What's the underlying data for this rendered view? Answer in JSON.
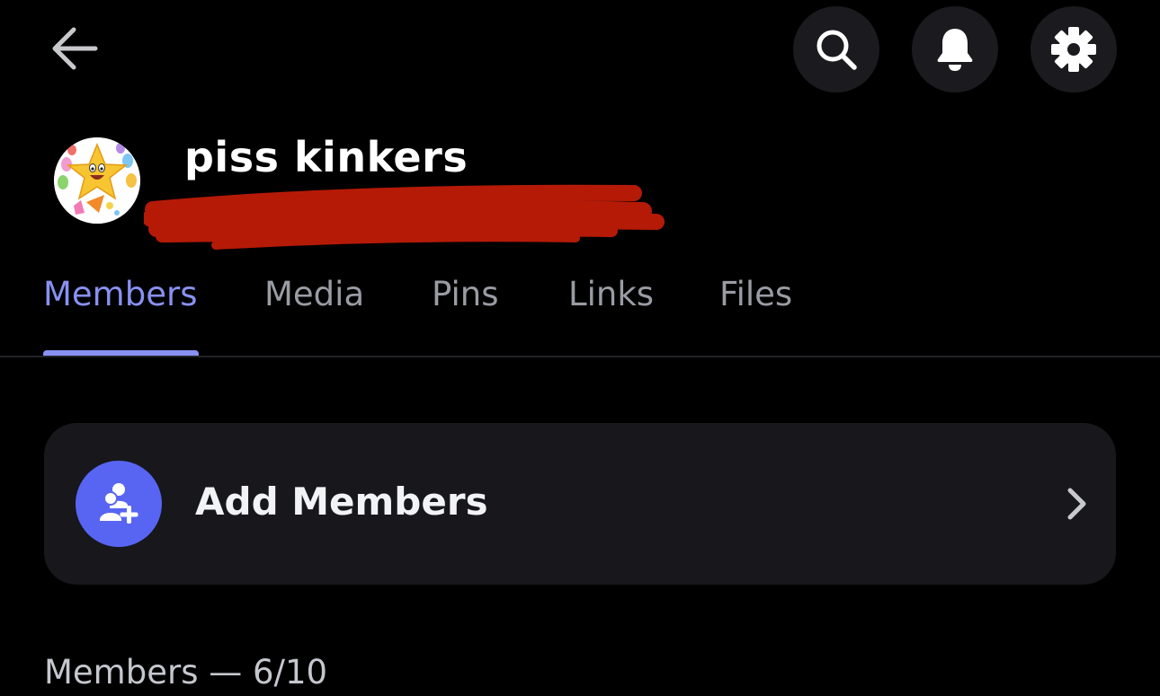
{
  "header": {
    "back_icon": "arrow-left-icon",
    "actions": [
      {
        "icon": "search-icon"
      },
      {
        "icon": "bell-icon"
      },
      {
        "icon": "gear-icon"
      }
    ]
  },
  "group": {
    "name": "piss kinkers",
    "avatar_icon": "star-party-avatar"
  },
  "tabs": [
    {
      "label": "Members",
      "active": true
    },
    {
      "label": "Media",
      "active": false
    },
    {
      "label": "Pins",
      "active": false
    },
    {
      "label": "Links",
      "active": false
    },
    {
      "label": "Files",
      "active": false
    }
  ],
  "add_members": {
    "label": "Add Members",
    "icon": "add-user-icon"
  },
  "members_section": {
    "label": "Members — 6/10"
  },
  "colors": {
    "background": "#000000",
    "accent": "#8891f2",
    "blurple": "#5865f2",
    "card": "#17171c",
    "redaction": "#b51a07"
  }
}
